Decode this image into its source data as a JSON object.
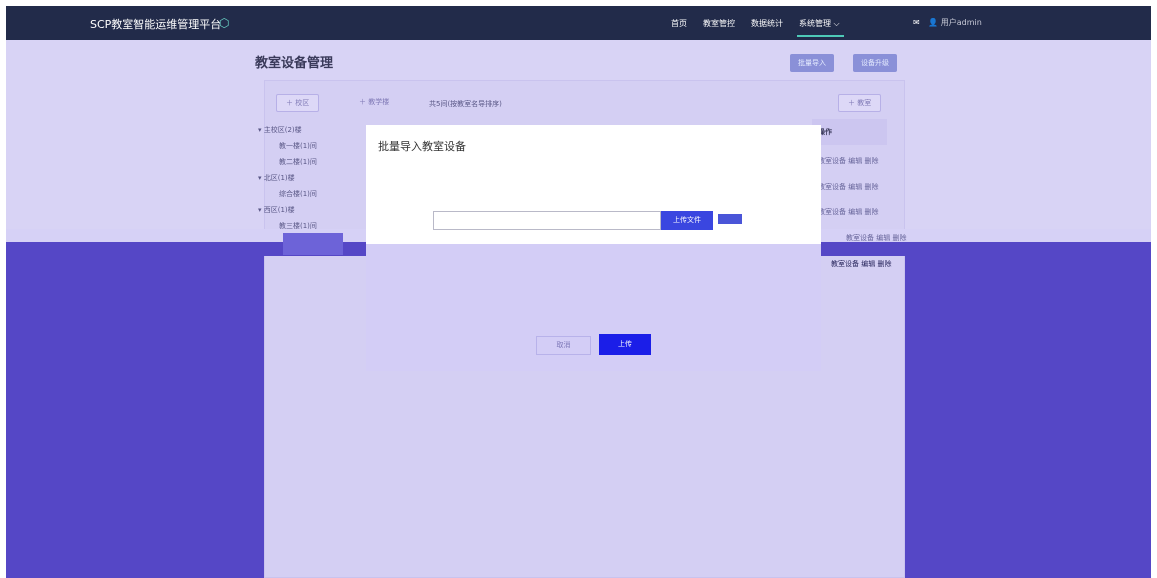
{
  "header": {
    "brand": "SCP教室智能运维管理平台",
    "brand_icon": "cube-icon",
    "nav": [
      "首页",
      "教室管控",
      "数据统计"
    ],
    "nav_active": "系统管理",
    "nav_active_caret": "⌵",
    "user_label": "用户admin"
  },
  "page": {
    "title": "教室设备管理",
    "batch_import_label": "批量导入",
    "device_upgrade_label": "设备升级",
    "add_campus_label": "＋ 校区",
    "add_building_label": "＋ 教学楼",
    "add_classroom_label": "＋ 教室",
    "summary": "共5间(按教室名导排序)",
    "operation_header": "操作",
    "row_ops": [
      "教室设备 编辑 删除",
      "教室设备 编辑 删除",
      "教室设备 编辑 删除",
      "教室设备 编辑 删除",
      "教室设备 编辑 删除"
    ]
  },
  "tree": {
    "nodes": [
      {
        "label": "主校区(2)楼",
        "level": 1
      },
      {
        "label": "教一楼(1)间",
        "level": 2
      },
      {
        "label": "教二楼(1)间",
        "level": 2
      },
      {
        "label": "北区(1)楼",
        "level": 1
      },
      {
        "label": "综合楼(1)间",
        "level": 2
      },
      {
        "label": "西区(1)楼",
        "level": 1
      },
      {
        "label": "教三楼(1)间",
        "level": 2
      }
    ]
  },
  "modal": {
    "title": "批量导入教室设备",
    "file_value": "",
    "upload_file_label": "上传文件",
    "cancel_label": "取消",
    "upload_label": "上传"
  },
  "colors": {
    "topbar": "#222b4a",
    "accent": "#4ec9b7",
    "mask": "#5547c6",
    "primary_button": "#1b1ee8"
  }
}
